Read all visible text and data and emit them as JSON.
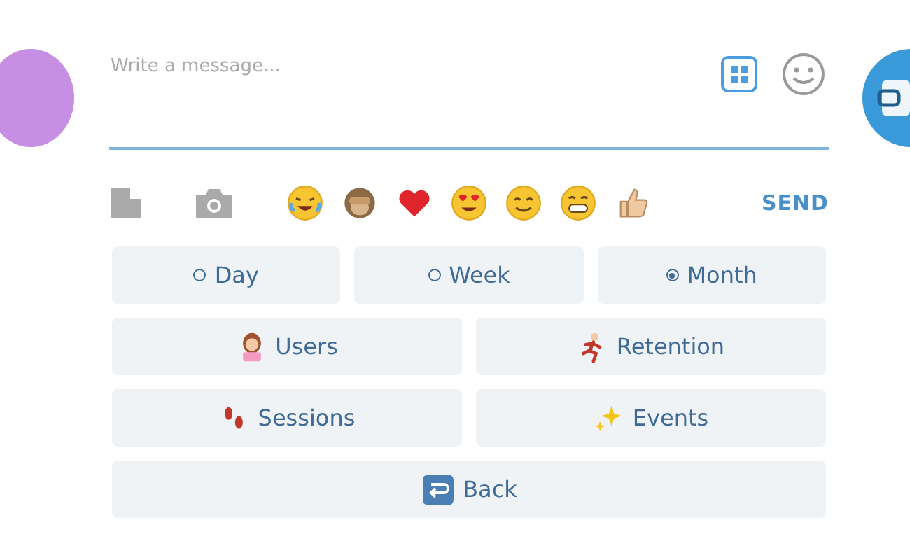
{
  "composer": {
    "placeholder": "Write a message..."
  },
  "toolbar": {
    "send": "SEND"
  },
  "keyboard": {
    "rows": [
      [
        {
          "kind": "period",
          "label": "Day",
          "selected": false
        },
        {
          "kind": "period",
          "label": "Week",
          "selected": false
        },
        {
          "kind": "period",
          "label": "Month",
          "selected": true
        }
      ],
      [
        {
          "kind": "metric",
          "label": "Users"
        },
        {
          "kind": "metric",
          "label": "Retention"
        }
      ],
      [
        {
          "kind": "metric",
          "label": "Sessions"
        },
        {
          "kind": "metric",
          "label": "Events"
        }
      ],
      [
        {
          "kind": "back",
          "label": "Back"
        }
      ]
    ]
  }
}
